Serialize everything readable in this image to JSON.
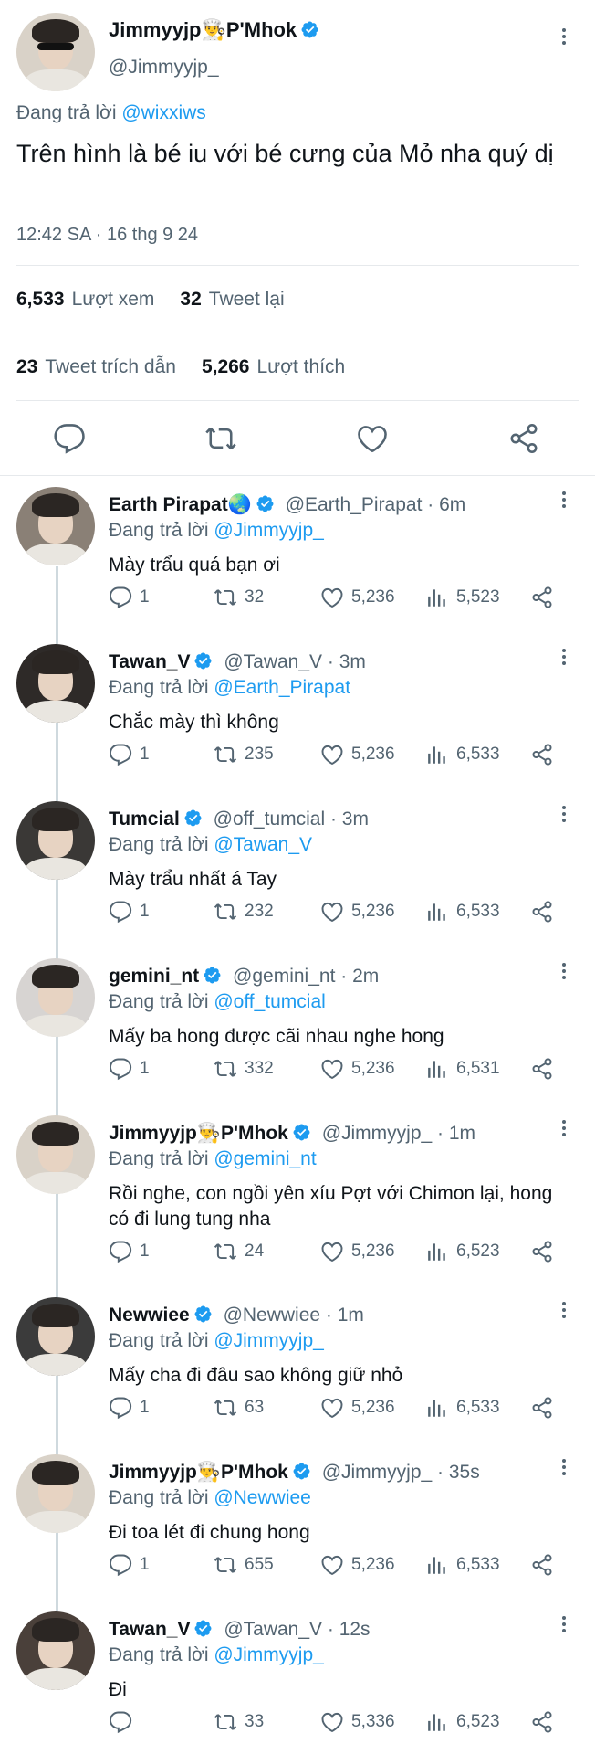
{
  "main": {
    "author_name": "Jimmyyjp👨‍🍳P'Mhok",
    "author_handle": "@Jimmyyjp_",
    "replying_prefix": "Đang trả lời",
    "replying_to": "@wixxiws",
    "text": "Trên hình là bé iu với bé cưng của Mỏ nha quý dị",
    "timestamp": "12:42 SA · 16 thg 9 24",
    "views_count": "6,533",
    "views_label": "Lượt xem",
    "retweets_count": "32",
    "retweets_label": "Tweet lại",
    "quotes_count": "23",
    "quotes_label": "Tweet trích dẫn",
    "likes_count": "5,266",
    "likes_label": "Lượt thích"
  },
  "colors": {
    "accent": "#1d9bf0",
    "secondary_text": "#536471",
    "divider": "#e6e9ec"
  },
  "icons": [
    "reply-icon",
    "retweet-icon",
    "like-icon",
    "share-icon",
    "views-icon",
    "verified-icon",
    "more-icon"
  ],
  "replies": [
    {
      "name": "Earth Pirapat🌏",
      "verified": true,
      "handle": "@Earth_Pirapat · 6m",
      "replying_to": "@Jimmyyjp_",
      "text": "Mày trẩu quá bạn ơi",
      "replies": "1",
      "retweets": "32",
      "likes": "5,236",
      "views": "5,523"
    },
    {
      "name": "Tawan_V",
      "verified": true,
      "handle": "@Tawan_V · 3m",
      "replying_to": "@Earth_Pirapat",
      "text": "Chắc mày thì không",
      "replies": "1",
      "retweets": "235",
      "likes": "5,236",
      "views": "6,533"
    },
    {
      "name": "Tumcial",
      "verified": true,
      "handle": "@off_tumcial · 3m",
      "replying_to": "@Tawan_V",
      "text": "Mày trẩu nhất á Tay",
      "replies": "1",
      "retweets": "232",
      "likes": "5,236",
      "views": "6,533"
    },
    {
      "name": "gemini_nt",
      "verified": true,
      "handle": "@gemini_nt · 2m",
      "replying_to": "@off_tumcial",
      "text": "Mấy ba hong được cãi nhau nghe hong",
      "replies": "1",
      "retweets": "332",
      "likes": "5,236",
      "views": "6,531"
    },
    {
      "name": "Jimmyyjp👨‍🍳P'Mhok",
      "verified": true,
      "handle": "@Jimmyyjp_ · 1m",
      "replying_to": "@gemini_nt",
      "text": "Rồi nghe, con ngồi yên xíu Pợt với Chimon lại, hong có đi lung tung nha",
      "replies": "1",
      "retweets": "24",
      "likes": "5,236",
      "views": "6,523"
    },
    {
      "name": "Newwiee",
      "verified": true,
      "handle": "@Newwiee · 1m",
      "replying_to": "@Jimmyyjp_",
      "text": "Mấy cha đi đâu sao không giữ nhỏ",
      "replies": "1",
      "retweets": "63",
      "likes": "5,236",
      "views": "6,533"
    },
    {
      "name": "Jimmyyjp👨‍🍳P'Mhok",
      "verified": true,
      "handle": "@Jimmyyjp_ · 35s",
      "replying_to": "@Newwiee",
      "text": "Đi toa lét đi chung hong",
      "replies": "1",
      "retweets": "655",
      "likes": "5,236",
      "views": "6,533"
    },
    {
      "name": "Tawan_V",
      "verified": true,
      "handle": "@Tawan_V · 12s",
      "replying_to": "@Jimmyyjp_",
      "text": "Đi",
      "replies": "",
      "retweets": "33",
      "likes": "5,336",
      "views": "6,523"
    }
  ]
}
